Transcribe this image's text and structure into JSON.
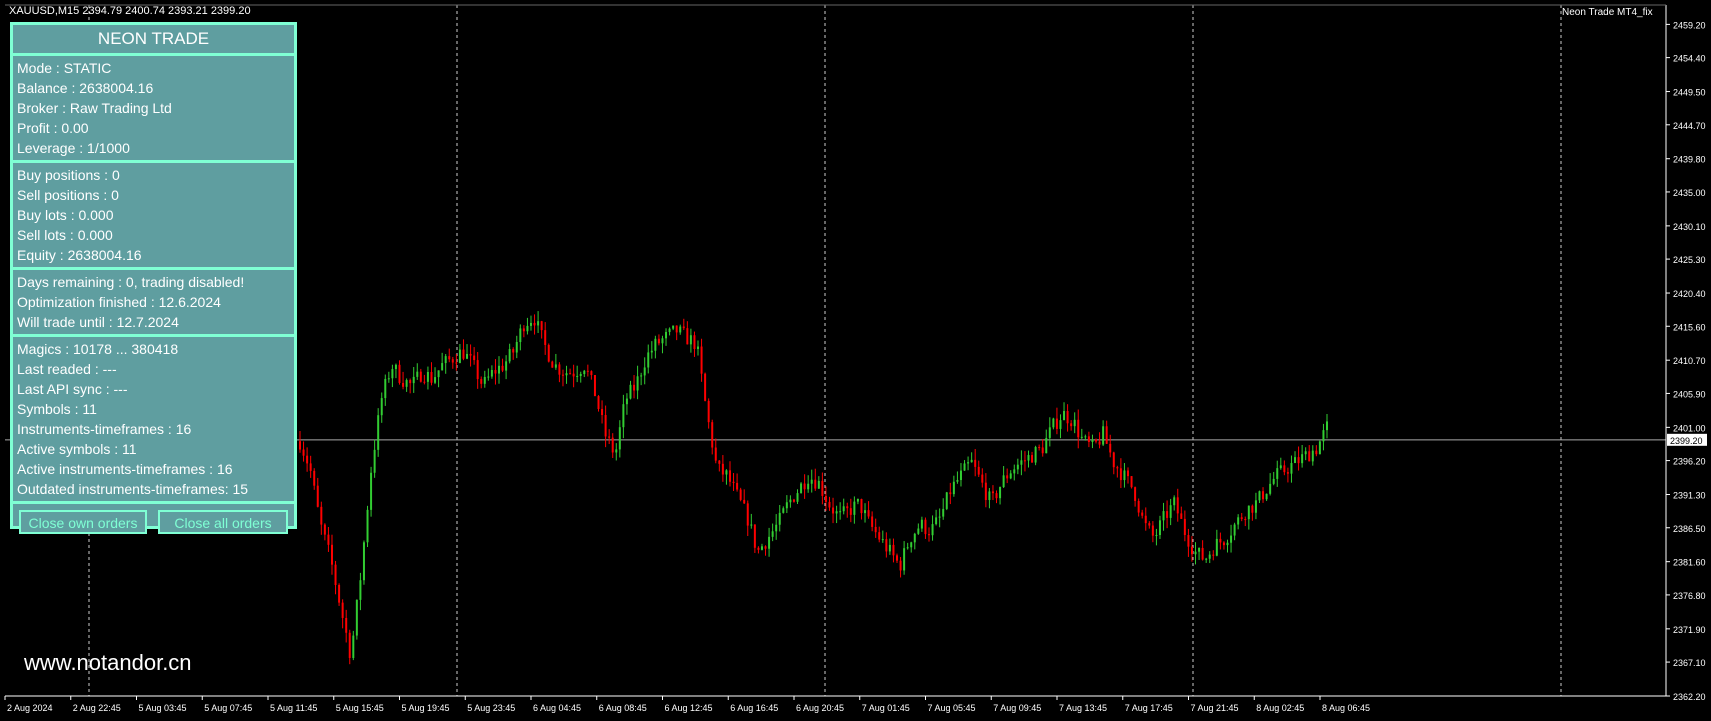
{
  "chart_header": {
    "symbol_timeframe": "XAUUSD,M15",
    "ohlc": "2394.79 2400.74 2393.21 2399.20",
    "ea_name": "Neon Trade MT4_fix"
  },
  "panel": {
    "title": "NEON TRADE",
    "account": [
      "Mode : STATIC",
      "Balance : 2638004.16",
      "Broker : Raw Trading Ltd",
      "Profit : 0.00",
      "Leverage : 1/1000"
    ],
    "positions": [
      "Buy positions : 0",
      "Sell positions : 0",
      "Buy lots : 0.000",
      "Sell lots : 0.000",
      "Equity : 2638004.16"
    ],
    "license": [
      "Days remaining : 0, trading disabled!",
      "Optimization finished : 12.6.2024",
      "Will trade until : 12.7.2024"
    ],
    "stats": [
      "Magics : 10178 ... 380418",
      "Last readed :  ---",
      "Last API sync :  ---",
      "Symbols : 11",
      "Instruments-timeframes : 16",
      "Active symbols : 11",
      "Active instruments-timeframes : 16",
      "Outdated instruments-timeframes: 15"
    ],
    "close_own_label": "Close own orders",
    "close_all_label": "Close all orders"
  },
  "watermark": "www.notandor.cn",
  "colors": {
    "bull": "#32cd32",
    "bear": "#ff0000",
    "background": "#000000",
    "panel_bg": "#5f9ea0",
    "panel_border": "#7fffd4"
  },
  "chart_data": {
    "type": "candlestick",
    "ylim": [
      2362.2,
      2462
    ],
    "current_price": "2399.20",
    "y_ticks": [
      "2459.20",
      "2454.40",
      "2449.50",
      "2444.70",
      "2439.80",
      "2435.00",
      "2430.10",
      "2425.30",
      "2420.40",
      "2415.60",
      "2410.70",
      "2405.90",
      "2401.00",
      "2396.20",
      "2391.30",
      "2386.50",
      "2381.60",
      "2376.80",
      "2371.90",
      "2367.10",
      "2362.20"
    ],
    "x_ticks": [
      "2 Aug 2024",
      "2 Aug 22:45",
      "5 Aug 03:45",
      "5 Aug 07:45",
      "5 Aug 11:45",
      "5 Aug 15:45",
      "5 Aug 19:45",
      "5 Aug 23:45",
      "6 Aug 04:45",
      "6 Aug 08:45",
      "6 Aug 12:45",
      "6 Aug 16:45",
      "6 Aug 20:45",
      "7 Aug 01:45",
      "7 Aug 05:45",
      "7 Aug 09:45",
      "7 Aug 13:45",
      "7 Aug 17:45",
      "7 Aug 21:45",
      "8 Aug 02:45",
      "8 Aug 06:45"
    ],
    "close_path": [
      2399,
      2395,
      2387,
      2382,
      2375,
      2368,
      2380,
      2395,
      2405,
      2410,
      2408,
      2407,
      2409,
      2408,
      2410,
      2411,
      2412,
      2410,
      2407,
      2409,
      2410,
      2412,
      2416,
      2417,
      2413,
      2410,
      2409,
      2409,
      2410,
      2406,
      2400,
      2397,
      2405,
      2407,
      2411,
      2413,
      2414,
      2415,
      2414,
      2413,
      2403,
      2395,
      2394,
      2391,
      2388,
      2383,
      2385,
      2387,
      2390,
      2392,
      2394,
      2393,
      2390,
      2388,
      2389,
      2390,
      2387,
      2385,
      2383,
      2381,
      2385,
      2387,
      2386,
      2388,
      2392,
      2394,
      2396,
      2393,
      2390,
      2393,
      2395,
      2396,
      2397,
      2398,
      2401,
      2403,
      2402,
      2399,
      2398,
      2400,
      2396,
      2394,
      2392,
      2387,
      2385,
      2388,
      2390,
      2386,
      2383,
      2382,
      2384,
      2385,
      2387,
      2389,
      2390,
      2392,
      2394,
      2395,
      2396,
      2397,
      2398,
      2401
    ]
  }
}
